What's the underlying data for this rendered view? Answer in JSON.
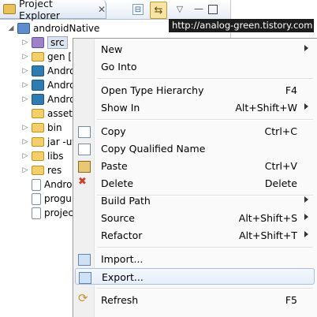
{
  "view": {
    "title": "Project Explorer",
    "close_glyph": "✕",
    "toolbar": {
      "collapse_glyph": "⊟",
      "link_glyph": "⇆",
      "menu_glyph": "▽",
      "minimize_glyph": "—"
    }
  },
  "watermark": "http://analog-green.tistory.com",
  "tree": {
    "expand_glyph": "◢",
    "collapse_glyph": "▷",
    "project": "androidNative",
    "items": [
      {
        "label": "src",
        "icon": "src-folder-icon"
      },
      {
        "label": "gen [",
        "icon": "gen-folder-icon"
      },
      {
        "label": "Andro",
        "icon": "android-library-icon"
      },
      {
        "label": "Andro",
        "icon": "android-library-icon"
      },
      {
        "label": "Andro",
        "icon": "android-library-icon"
      },
      {
        "label": "assets",
        "icon": "folder-icon"
      },
      {
        "label": "bin",
        "icon": "folder-icon"
      },
      {
        "label": "jar -ut",
        "icon": "folder-icon"
      },
      {
        "label": "libs",
        "icon": "folder-icon"
      },
      {
        "label": "res",
        "icon": "folder-icon"
      },
      {
        "label": "Andro",
        "icon": "manifest-file-icon"
      },
      {
        "label": "progu",
        "icon": "file-icon"
      },
      {
        "label": "projec",
        "icon": "file-icon"
      }
    ]
  },
  "context_menu": {
    "items": [
      {
        "label": "New",
        "shortcut": "",
        "submenu": true
      },
      {
        "label": "Go Into",
        "shortcut": ""
      },
      {
        "label": "Open Type Hierarchy",
        "shortcut": "F4"
      },
      {
        "label": "Show In",
        "shortcut": "Alt+Shift+W",
        "submenu": true
      },
      {
        "label": "Copy",
        "shortcut": "Ctrl+C",
        "icon": "copy-icon"
      },
      {
        "label": "Copy Qualified Name",
        "shortcut": "",
        "icon": "copy-qualified-name-icon"
      },
      {
        "label": "Paste",
        "shortcut": "Ctrl+V",
        "icon": "paste-icon"
      },
      {
        "label": "Delete",
        "shortcut": "Delete",
        "icon": "delete-icon"
      },
      {
        "label": "Build Path",
        "shortcut": "",
        "submenu": true
      },
      {
        "label": "Source",
        "shortcut": "Alt+Shift+S",
        "submenu": true
      },
      {
        "label": "Refactor",
        "shortcut": "Alt+Shift+T",
        "submenu": true
      },
      {
        "label": "Import...",
        "shortcut": "",
        "icon": "import-icon"
      },
      {
        "label": "Export...",
        "shortcut": "",
        "icon": "export-icon",
        "highlighted": true
      },
      {
        "label": "Refresh",
        "shortcut": "F5",
        "icon": "refresh-icon"
      }
    ]
  }
}
